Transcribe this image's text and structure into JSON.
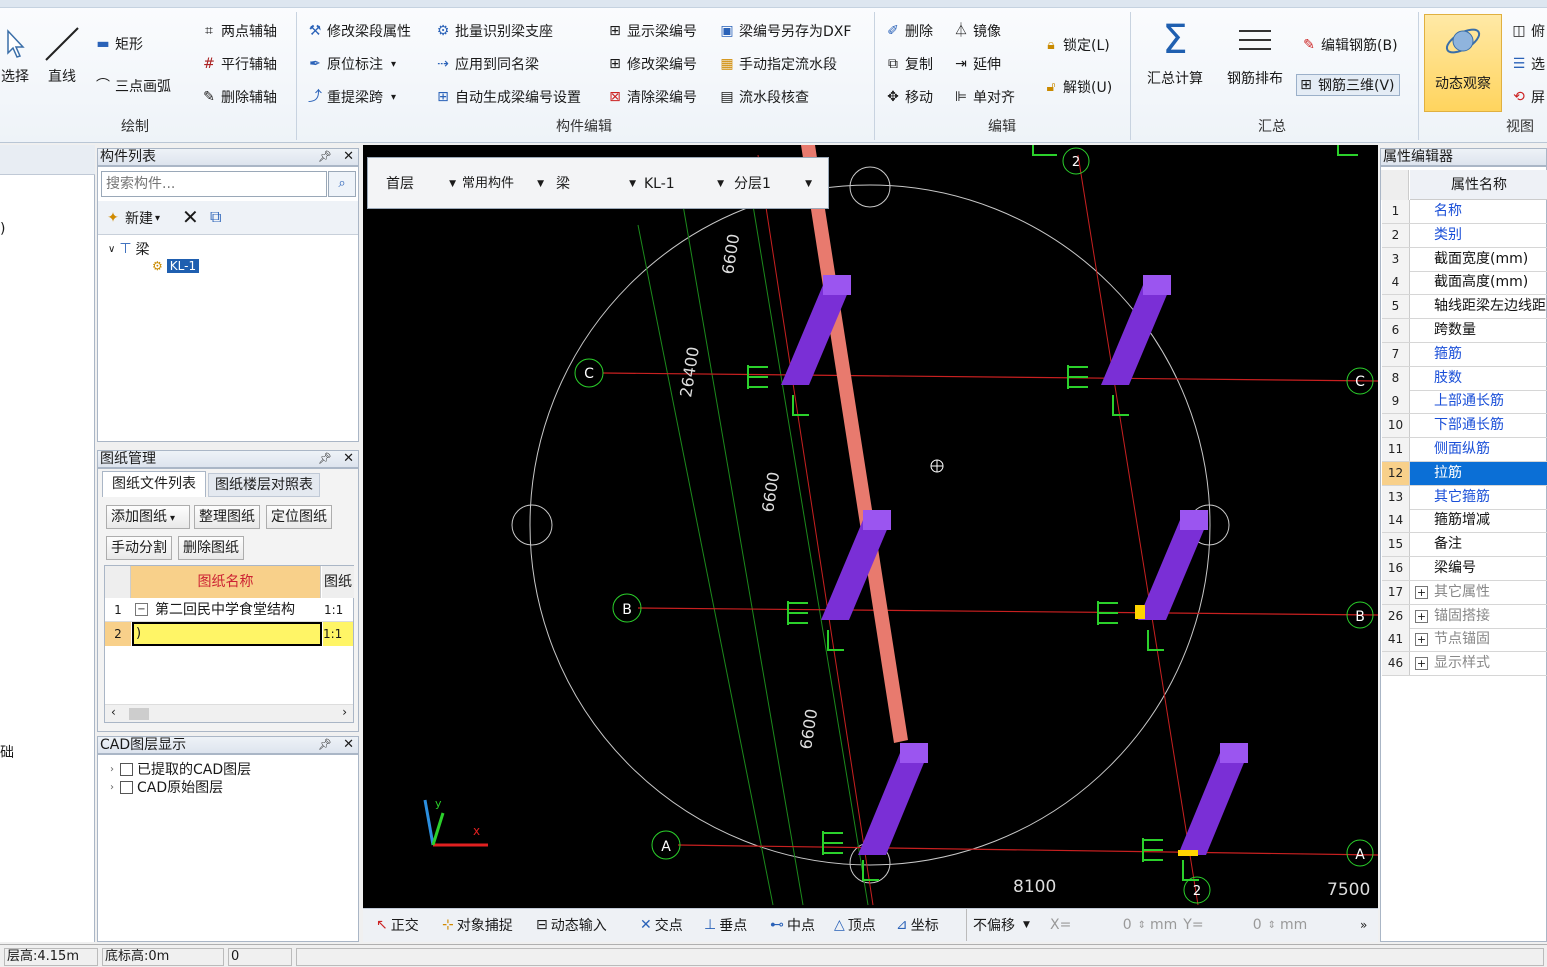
{
  "ribbon": {
    "draw": {
      "select": "选择",
      "line": "直线",
      "rect": "矩形",
      "arc": "三点画弧",
      "two_pt_axis": "两点辅轴",
      "parallel_axis": "平行辅轴",
      "del_axis": "删除辅轴",
      "group": "绘制"
    },
    "edit_comp": {
      "modify_seg": "修改梁段属性",
      "orig_note": "原位标注",
      "re_span": "重提梁跨",
      "batch_id": "批量识别梁支座",
      "apply_same": "应用到同名梁",
      "auto_num": "自动生成梁编号设置",
      "show_num": "显示梁编号",
      "modify_num": "修改梁编号",
      "clear_num": "清除梁编号",
      "save_dxf": "梁编号另存为DXF",
      "manual_flow": "手动指定流水段",
      "flow_check": "流水段核查",
      "group": "构件编辑"
    },
    "edit": {
      "delete": "删除",
      "mirror": "镜像",
      "copy": "复制",
      "extend": "延伸",
      "move": "移动",
      "align": "单对齐",
      "lock": "锁定(L)",
      "unlock": "解锁(U)",
      "group": "编辑"
    },
    "summary": {
      "calc": "汇总计算",
      "layout": "钢筋排布",
      "edit_rebar": "编辑钢筋(B)",
      "rebar3d": "钢筋三维(V)",
      "group": "汇总"
    },
    "view": {
      "dynamic": "动态观察",
      "top": "俯",
      "select": "选",
      "screen": "屏",
      "group": "视图"
    }
  },
  "comp_list": {
    "title": "构件列表",
    "search_placeholder": "搜索构件...",
    "new": "新建",
    "tree_root": "梁",
    "tree_item": "KL-1"
  },
  "drawing_mgmt": {
    "title": "图纸管理",
    "tab1": "图纸文件列表",
    "tab2": "图纸楼层对照表",
    "add": "添加图纸",
    "organize": "整理图纸",
    "locate": "定位图纸",
    "split": "手动分割",
    "delete": "删除图纸",
    "col_name": "图纸名称",
    "col_scale": "图纸",
    "rows": [
      {
        "n": "1",
        "name": "第二回民中学食堂结构",
        "scale": "1:1"
      },
      {
        "n": "2",
        "name": ")",
        "scale": "1:1"
      }
    ]
  },
  "cad_layers": {
    "title": "CAD图层显示",
    "l1": "已提取的CAD图层",
    "l2": "CAD原始图层"
  },
  "toolbar": {
    "floor": "首层",
    "type": "常用构件",
    "comp": "梁",
    "name": "KL-1",
    "layer": "分层1"
  },
  "canvas": {
    "dim1": "6600",
    "dim2": "26400",
    "dim3": "6600",
    "dim4": "6600",
    "dim5": "8100",
    "dim6": "7500",
    "axisA": "A",
    "axisB": "B",
    "axisC": "C",
    "axis2": "2"
  },
  "snapbar": {
    "ortho": "正交",
    "snap": "对象捕捉",
    "dyn": "动态输入",
    "intersect": "交点",
    "perp": "垂点",
    "mid": "中点",
    "vertex": "顶点",
    "coord": "坐标",
    "offset": "不偏移",
    "x_label": "X=",
    "x_val": "0",
    "mm1": "mm",
    "y_label": "Y=",
    "y_val": "0",
    "mm2": "mm"
  },
  "props": {
    "title": "属性编辑器",
    "header": "属性名称",
    "rows": [
      {
        "n": "1",
        "name": "名称",
        "blue": true
      },
      {
        "n": "2",
        "name": "类别",
        "blue": true
      },
      {
        "n": "3",
        "name": "截面宽度(mm)"
      },
      {
        "n": "4",
        "name": "截面高度(mm)"
      },
      {
        "n": "5",
        "name": "轴线距梁左边线距"
      },
      {
        "n": "6",
        "name": "跨数量"
      },
      {
        "n": "7",
        "name": "箍筋",
        "blue": true
      },
      {
        "n": "8",
        "name": "肢数",
        "blue": true
      },
      {
        "n": "9",
        "name": "上部通长筋",
        "blue": true
      },
      {
        "n": "10",
        "name": "下部通长筋",
        "blue": true
      },
      {
        "n": "11",
        "name": "侧面纵筋",
        "blue": true
      },
      {
        "n": "12",
        "name": "拉筋",
        "blue": true,
        "sel": true
      },
      {
        "n": "13",
        "name": "其它箍筋",
        "blue": true
      },
      {
        "n": "14",
        "name": "箍筋增减"
      },
      {
        "n": "15",
        "name": "备注"
      },
      {
        "n": "16",
        "name": "梁编号"
      },
      {
        "n": "17",
        "name": "其它属性",
        "grey": true,
        "exp": true
      },
      {
        "n": "26",
        "name": "锚固搭接",
        "grey": true,
        "exp": true
      },
      {
        "n": "41",
        "name": "节点锚固",
        "grey": true,
        "exp": true
      },
      {
        "n": "46",
        "name": "显示样式",
        "grey": true,
        "exp": true
      }
    ]
  },
  "left_stub": {
    "a": ")",
    "b": "础"
  },
  "status": {
    "floor_h": "层高:4.15m",
    "bottom_h": "底标高:0m",
    "val": "0"
  }
}
